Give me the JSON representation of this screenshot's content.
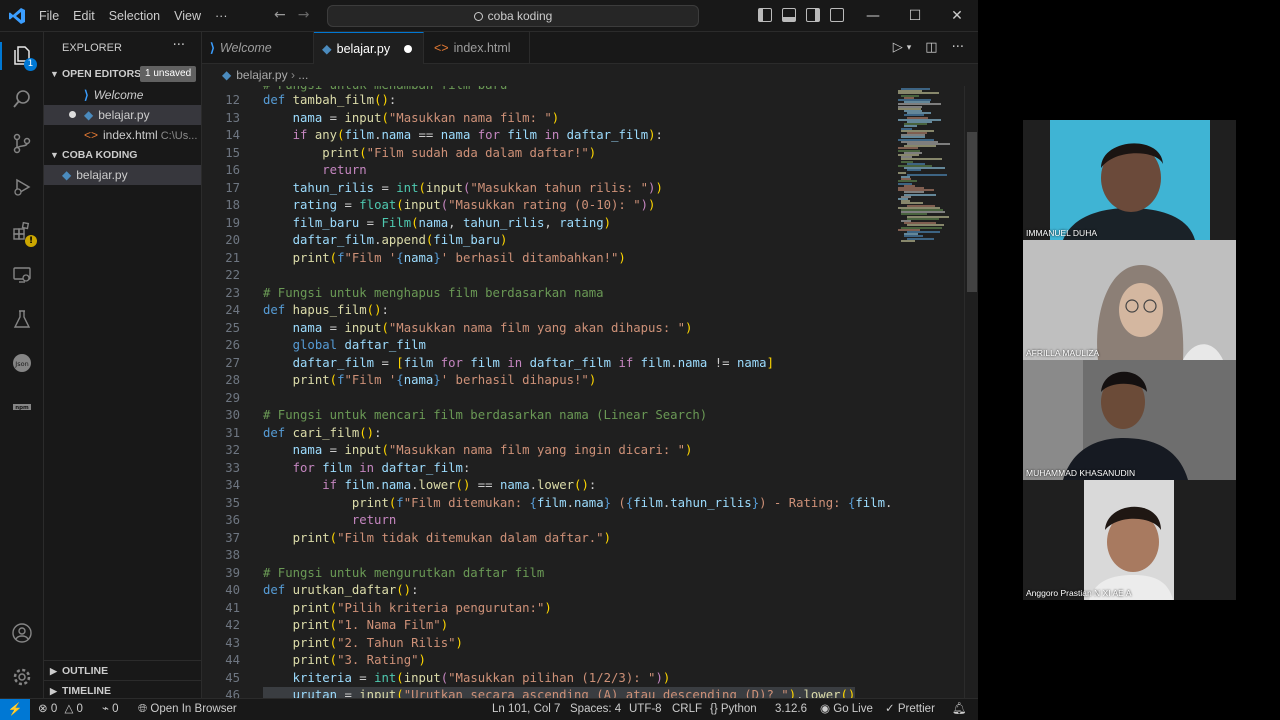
{
  "titlebar": {
    "menus": [
      "File",
      "Edit",
      "Selection",
      "View",
      "···"
    ],
    "search": "coba koding",
    "window_controls": [
      "—",
      "☐",
      "✕"
    ]
  },
  "sidebar": {
    "title": "EXPLORER",
    "more": "···",
    "open_editors_label": "OPEN EDITORS",
    "unsaved_badge": "1 unsaved",
    "open_editors": [
      {
        "name": "Welcome",
        "icon": "vscode-icon"
      },
      {
        "name": "belajar.py",
        "icon": "python-icon",
        "modified": true
      },
      {
        "name": "index.html",
        "icon": "html-icon",
        "path": "C:\\Us..."
      }
    ],
    "folder_label": "COBA KODING",
    "folder_files": [
      {
        "name": "belajar.py",
        "icon": "python-icon"
      }
    ],
    "outline_label": "OUTLINE",
    "timeline_label": "TIMELINE"
  },
  "tabs": [
    {
      "label": "Welcome",
      "icon": "vscode-icon",
      "active": false
    },
    {
      "label": "belajar.py",
      "icon": "python-icon",
      "active": true,
      "modified": true
    },
    {
      "label": "index.html",
      "icon": "html-icon",
      "active": false
    }
  ],
  "breadcrumb": {
    "file": "belajar.py",
    "rest": "..."
  },
  "partial_top_comment": "# Fungsi untuk menambah film baru",
  "code_lines": [
    12,
    13,
    14,
    15,
    16,
    17,
    18,
    19,
    20,
    21,
    22,
    23,
    24,
    25,
    26,
    27,
    28,
    29,
    30,
    31,
    32,
    33,
    34,
    35,
    36,
    37,
    38,
    39,
    40,
    41,
    42,
    43,
    44,
    45,
    46
  ],
  "statusbar": {
    "errors": "0",
    "warnings": "0",
    "ports": "0",
    "open_in_browser": "Open In Browser",
    "position": "Ln 101, Col 7",
    "spaces": "Spaces: 4",
    "encoding": "UTF-8",
    "eol": "CRLF",
    "language": "Python",
    "version": "3.12.6",
    "go_live": "Go Live",
    "prettier": "Prettier"
  },
  "participants": [
    {
      "name": "IMMANUEL DUHA"
    },
    {
      "name": "AFRILLA MAULIZA"
    },
    {
      "name": "MUHAMMAD KHASANUDIN"
    },
    {
      "name": "Anggoro Prastian N XI AE A"
    }
  ],
  "colors": {
    "accent": "#0078d4",
    "editor_bg": "#1f1f1f",
    "chrome_bg": "#181818"
  }
}
